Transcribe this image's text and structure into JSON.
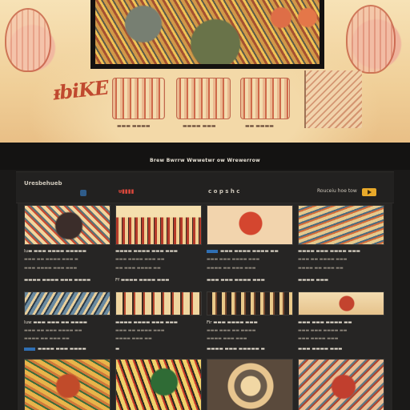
{
  "hero": {
    "title": "ᵻbiKE",
    "tags": [
      {
        "caption": "▬▬▬ ▬▬▬▬"
      },
      {
        "caption": "▬▬▬▬ ▬▬▬"
      },
      {
        "caption": "▬▬ ▬▬▬▬"
      }
    ]
  },
  "band": {
    "title": "Brew Bwrrw Wwwetwr ow Wrewerrow"
  },
  "toolbar": {
    "brand": "Uresbehueb",
    "nav": [
      "ᵾ▮▮▮▮",
      "c o p s h c",
      "Rouceiu hoe tow"
    ],
    "go_label": ""
  },
  "columns": [
    {
      "rows": [
        {
          "title": "Iu▬ ▬▬▬ ▬▬▬▬ ▬▬▬▬▬",
          "meta": "▬▬▬ ▬▬ ▬▬▬▬ ▬▬▬ ▬",
          "meta2": "▬▬▬ ▬▬▬▬ ▬▬▬ ▬▬▬"
        },
        {
          "title": "▬▬▬▬ ▬▬▬▬ ▬▬▬ ▬▬▬▬"
        },
        {
          "title": "Iuw ▬▬▬ ▬▬▬ ▬▬ ▬▬▬▬",
          "meta": "▬▬▬ ▬▬ ▬▬▬ ▬▬▬▬ ▬▬",
          "meta2": "▬▬▬▬ ▬▬ ▬▬▬ ▬▬"
        },
        {
          "title": "▬▬▬▬ ▬▬▬ ▬▬▬▬"
        }
      ]
    },
    {
      "rows": [
        {
          "title": "▬▬▬▬ ▬▬▬▬ ▬▬▬ ▬▬▬",
          "meta": "▬▬▬ ▬▬▬▬ ▬▬▬ ▬▬",
          "meta2": "▬▬ ▬▬▬ ▬▬▬▬ ▬▬"
        },
        {
          "title": "Ff ▬▬▬▬ ▬▬▬▬ ▬▬▬"
        },
        {
          "title": "▬▬▬▬ ▬▬▬▬ ▬▬▬ ▬▬▬",
          "meta": "▬▬▬ ▬▬ ▬▬▬▬ ▬▬▬",
          "meta2": "▬▬▬▬ ▬▬▬ ▬▬"
        },
        {
          "title": "▬"
        }
      ]
    },
    {
      "rows": [
        {
          "title": "▬▬▬ ▬▬▬▬ ▬▬▬▬ ▬▬",
          "meta": "▬▬▬ ▬▬▬ ▬▬▬▬ ▬▬▬",
          "meta2": "▬▬▬▬ ▬▬ ▬▬▬ ▬▬▬"
        },
        {
          "title": "▬▬▬ ▬▬▬ ▬▬▬▬ ▬▬▬"
        },
        {
          "title": "Fir ▬▬▬ ▬▬▬▬ ▬▬▬",
          "meta": "▬▬▬ ▬▬▬ ▬▬ ▬▬▬▬",
          "meta2": "▬▬▬▬ ▬▬▬ ▬▬▬"
        },
        {
          "title": "▬▬▬▬ ▬▬▬ ▬▬▬▬▬ ▬"
        }
      ]
    },
    {
      "rows": [
        {
          "title": "▬▬▬▬ ▬▬▬ ▬▬▬▬ ▬▬▬",
          "meta": "▬▬▬ ▬▬ ▬▬▬▬ ▬▬▬",
          "meta2": "▬▬▬▬ ▬▬ ▬▬▬ ▬▬"
        },
        {
          "title": "▬▬▬▬ ▬▬▬"
        },
        {
          "title": "▬▬▬ ▬▬▬ ▬▬▬▬ ▬▬",
          "meta": "▬▬▬ ▬▬▬ ▬▬▬▬ ▬▬",
          "meta2": "▬▬▬ ▬▬▬▬ ▬▬▬"
        },
        {
          "title": "▬▬▬ ▬▬▬▬ ▬▬▬"
        }
      ]
    }
  ],
  "colors": {
    "background": "#1a1918",
    "panel": "#262524",
    "accent_red": "#d9473b",
    "accent_yellow": "#e8a92a",
    "accent_blue": "#2f6fb3"
  }
}
